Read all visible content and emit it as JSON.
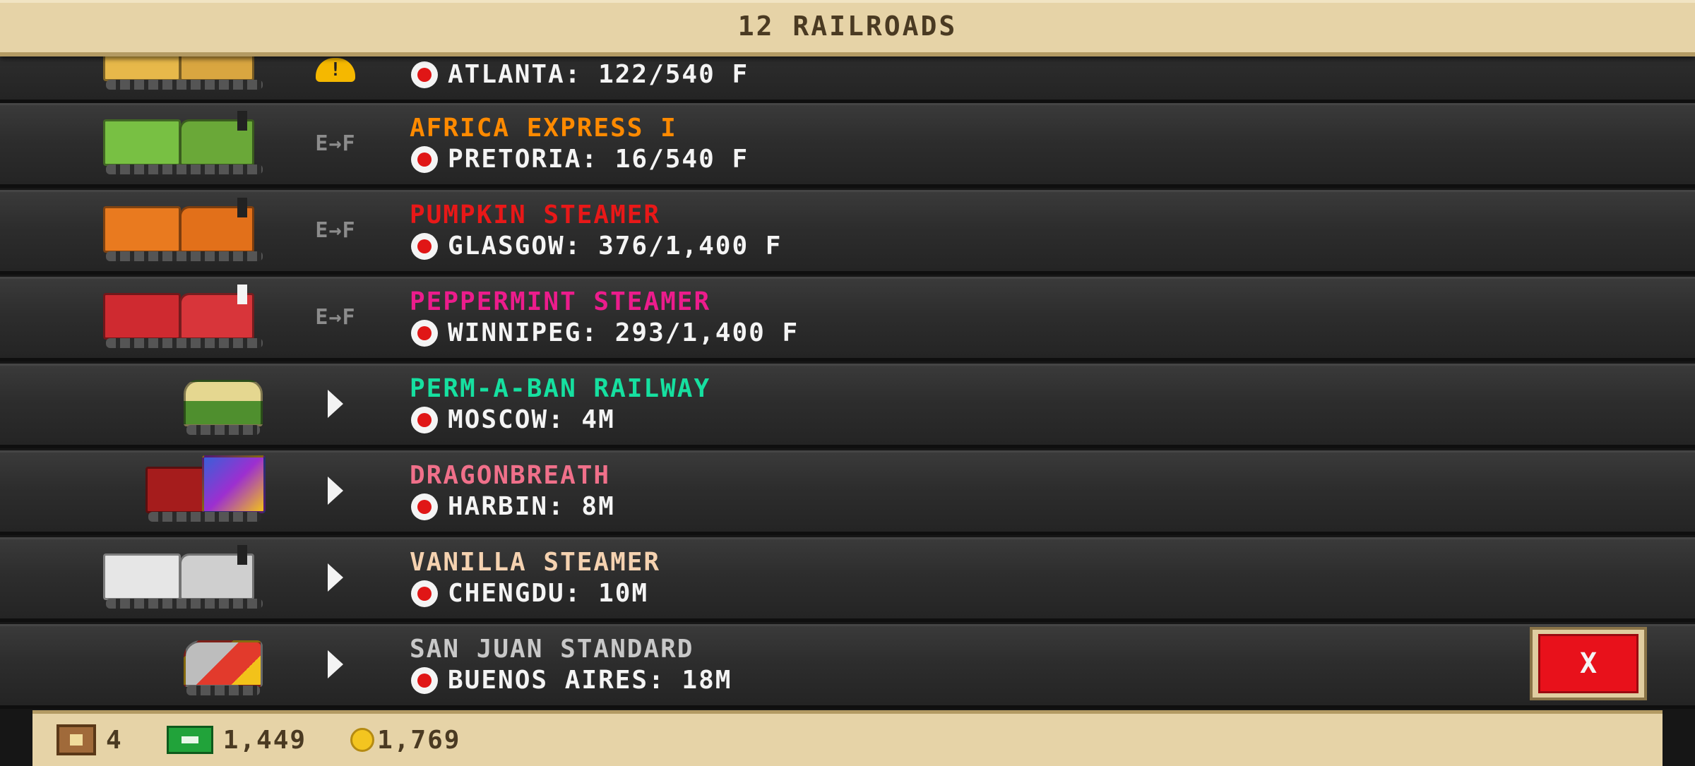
{
  "header": {
    "title": "12 RAILROADS"
  },
  "rows": [
    {
      "name": "",
      "destination": "ATLANTA: 122/540 F",
      "status": "warning",
      "name_color": "#ff8a00",
      "train_colors": [
        "#e7b84a",
        "#d9a640"
      ]
    },
    {
      "name": "AFRICA EXPRESS I",
      "destination": "PRETORIA: 16/540 F",
      "status": "E→F",
      "name_color": "#ff8a00",
      "train_colors": [
        "#78c043",
        "#6aa838"
      ]
    },
    {
      "name": "PUMPKIN STEAMER",
      "destination": "GLASGOW: 376/1,400 F",
      "status": "E→F",
      "name_color": "#e81818",
      "train_colors": [
        "#e97a1f",
        "#e2701a"
      ]
    },
    {
      "name": "PEPPERMINT STEAMER",
      "destination": "WINNIPEG: 293/1,400 F",
      "status": "E→F",
      "name_color": "#ec1c8c",
      "train_colors": [
        "#cf2a30",
        "#d8353a"
      ]
    },
    {
      "name": "PERM-A-BAN RAILWAY",
      "destination": "MOSCOW: 4M",
      "status": "play",
      "name_color": "#16e0a0",
      "train_colors": [
        "#4f8f2e",
        "#e5d790"
      ]
    },
    {
      "name": "DRAGONBREATH",
      "destination": "HARBIN: 8M",
      "status": "play",
      "name_color": "#f0708a",
      "train_colors": [
        "#a51c1c",
        "#3a5fd8"
      ]
    },
    {
      "name": "VANILLA STEAMER",
      "destination": "CHENGDU: 10M",
      "status": "play",
      "name_color": "#f5d2b0",
      "train_colors": [
        "#e6e6e6",
        "#cfcfcf"
      ]
    },
    {
      "name": "SAN JUAN STANDARD",
      "destination": "BUENOS AIRES: 18M",
      "status": "play",
      "name_color": "#c8c8c8",
      "train_colors": [
        "#bdbdbd",
        "#e23a2c"
      ]
    }
  ],
  "close_button": {
    "label": "X"
  },
  "footer": {
    "crates": "4",
    "cash": "1,449",
    "coins": "1,769"
  }
}
